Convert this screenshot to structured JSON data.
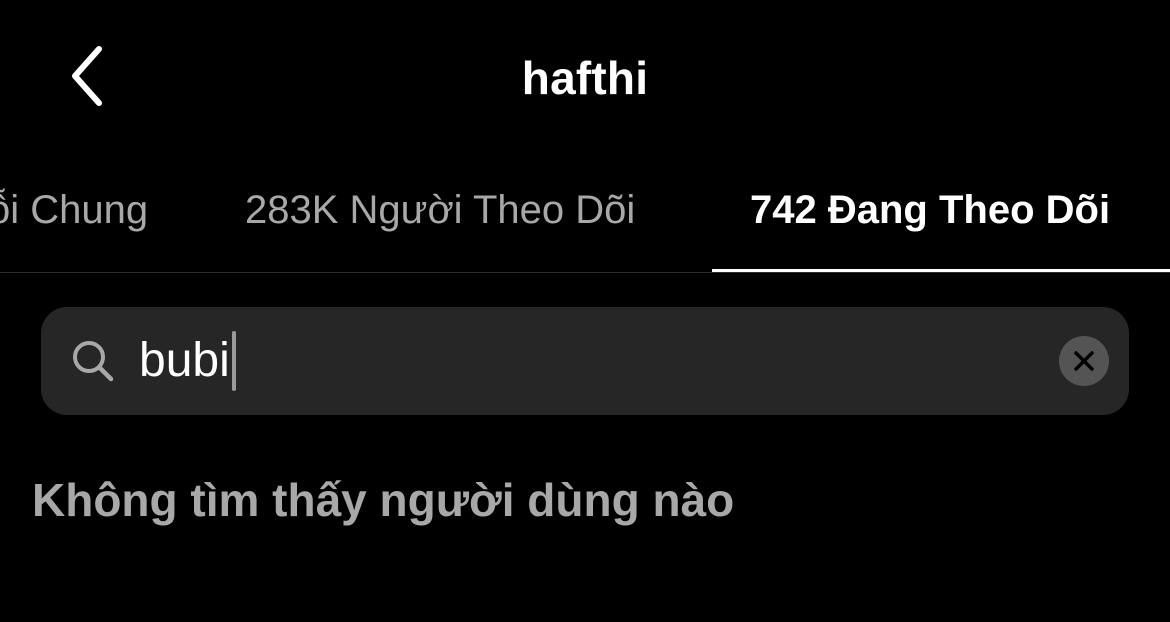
{
  "header": {
    "title": "hafthi",
    "back_icon": "chevron-left-icon"
  },
  "tabs": [
    {
      "label": "ỗi Chung",
      "active": false
    },
    {
      "label": "283K Người Theo Dõi",
      "active": false
    },
    {
      "label": "742 Đang Theo Dõi",
      "active": true
    }
  ],
  "search": {
    "value": "bubi",
    "icon": "search-icon",
    "clear_icon": "close-icon"
  },
  "results": {
    "empty_message": "Không tìm thấy người dùng nào"
  },
  "colors": {
    "background": "#000000",
    "search_bg": "#262626",
    "muted_text": "#a8a8a8",
    "active_text": "#ffffff"
  }
}
